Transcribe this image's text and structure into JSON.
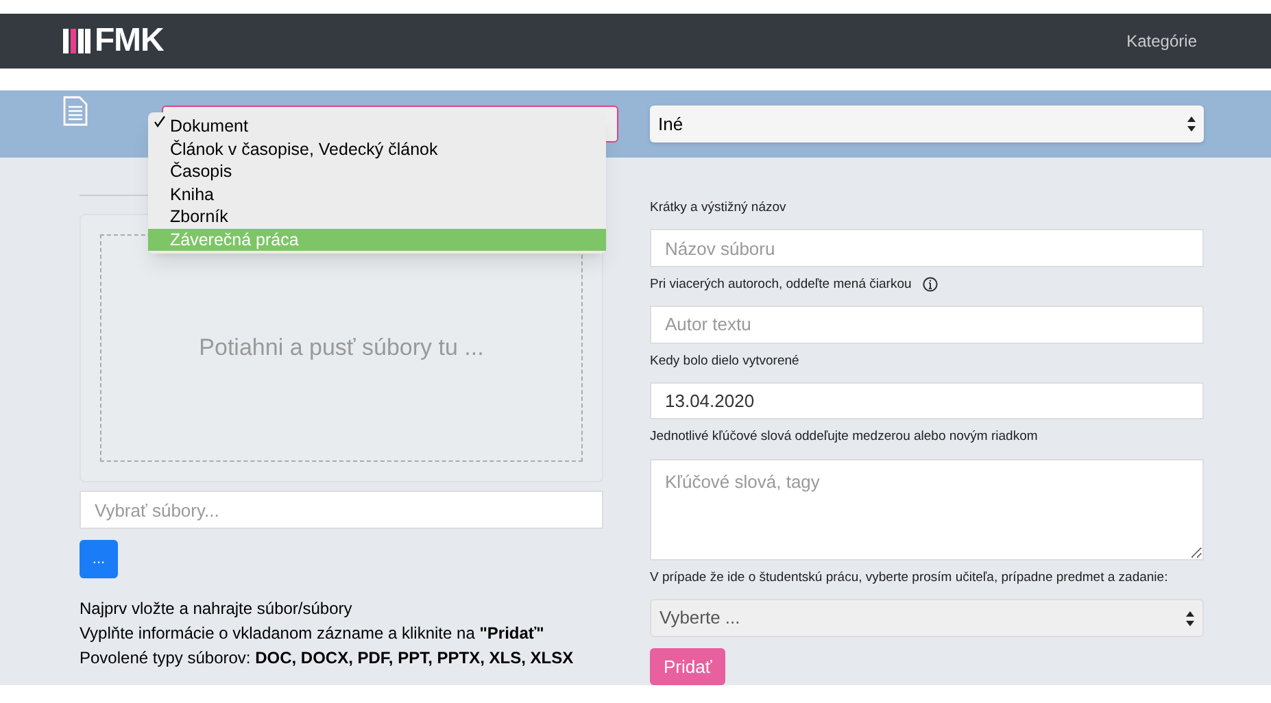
{
  "header": {
    "logo": "FMK",
    "nav": [
      {
        "label": "Kategórie"
      }
    ]
  },
  "type_select": {
    "open": true,
    "options": [
      {
        "label": "Dokument",
        "checked": true,
        "selected": false
      },
      {
        "label": "Článok v časopise, Vedecký článok",
        "checked": false,
        "selected": false
      },
      {
        "label": "Časopis",
        "checked": false,
        "selected": false
      },
      {
        "label": "Kniha",
        "checked": false,
        "selected": false
      },
      {
        "label": "Zborník",
        "checked": false,
        "selected": false
      },
      {
        "label": "Záverečná práca",
        "checked": false,
        "selected": true
      }
    ]
  },
  "category_select": {
    "value": "Iné"
  },
  "upload": {
    "dropzone_text": "Potiahni a pusť súbory tu ...",
    "file_field": {
      "placeholder": "Vybrať súbory..."
    },
    "browse_button": "...",
    "help": [
      "Najprv vložte a nahrajte súbor/súbory",
      "Vyplňte informácie o vkladanom zázname a kliknite na **\"Pridať\"**",
      "Povolené typy súborov: **DOC, DOCX, PDF, PPT, PPTX, XLS, XLSX**"
    ]
  },
  "form": {
    "fields": [
      {
        "kind": "input",
        "label": "Krátky a výstižný názov",
        "placeholder": "Názov súboru"
      },
      {
        "kind": "input",
        "label": "Pri viacerých autoroch, oddeľte mená čiarkou",
        "info": true,
        "placeholder": "Autor textu"
      },
      {
        "kind": "input",
        "label": "Kedy bolo dielo vytvorené",
        "value": "13.04.2020"
      },
      {
        "kind": "textarea",
        "label": "Jednotlivé kľúčové slová oddeľujte medzerou alebo novým riadkom",
        "placeholder": "Kľúčové slová, tagy"
      },
      {
        "kind": "select",
        "label": "V prípade že ide o študentskú prácu, vyberte prosím učiteľa, prípadne predmet a zadanie:",
        "value": "Vyberte ..."
      }
    ],
    "submit": "Pridať"
  }
}
